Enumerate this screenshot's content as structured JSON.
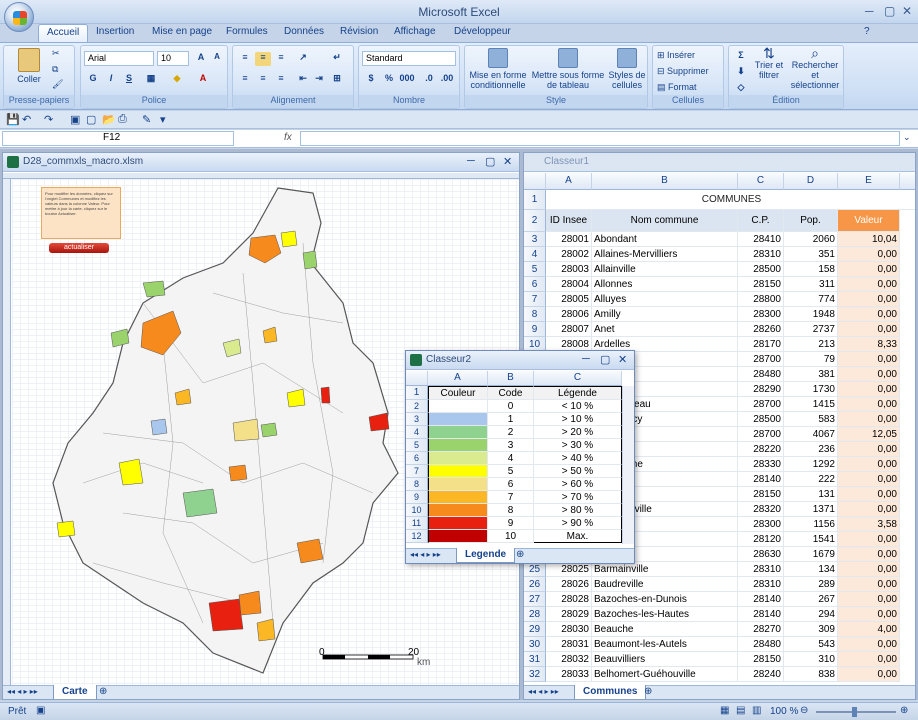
{
  "app": {
    "title": "Microsoft Excel"
  },
  "tabs": [
    "Accueil",
    "Insertion",
    "Mise en page",
    "Formules",
    "Données",
    "Révision",
    "Affichage",
    "Développeur"
  ],
  "ribbon": {
    "clipboard": {
      "label": "Presse-papiers",
      "paste": "Coller"
    },
    "font": {
      "label": "Police",
      "name": "Arial",
      "size": "10"
    },
    "alignment": {
      "label": "Alignement"
    },
    "number": {
      "label": "Nombre",
      "format": "Standard"
    },
    "style": {
      "label": "Style",
      "cond": "Mise en forme conditionnelle",
      "table": "Mettre sous forme de tableau",
      "cells": "Styles de cellules"
    },
    "cells": {
      "label": "Cellules",
      "insert": "Insérer",
      "delete": "Supprimer",
      "format": "Format"
    },
    "edit": {
      "label": "Édition",
      "sort": "Trier et filtrer",
      "find": "Rechercher et sélectionner"
    }
  },
  "formula": {
    "namebox": "F12",
    "fx": "fx"
  },
  "win1": {
    "title": "D28_commxls_macro.xlsm",
    "tab": "Carte",
    "btn": "actualiser",
    "note": "Pour modifier les données, cliquez sur l'onglet Communes et modifiez les valeurs dans la colonne Valeur. Pour mettre à jour la carte, cliquez sur le bouton Actualiser.",
    "scale0": "0",
    "scale20": "20",
    "scaleunit": "km"
  },
  "win2": {
    "title": "Classeur1",
    "tab": "Communes",
    "cols": [
      "A",
      "B",
      "C",
      "D",
      "E"
    ],
    "header": "COMMUNES",
    "colnames": {
      "id": "ID Insee",
      "nom": "Nom commune",
      "cp": "C.P.",
      "pop": "Pop.",
      "val": "Valeur"
    },
    "rows": [
      [
        "3",
        "28001",
        "Abondant",
        "28410",
        "2060",
        "10,04"
      ],
      [
        "4",
        "28002",
        "Allaines-Mervilliers",
        "28310",
        "351",
        "0,00"
      ],
      [
        "5",
        "28003",
        "Allainville",
        "28500",
        "158",
        "0,00"
      ],
      [
        "6",
        "28004",
        "Allonnes",
        "28150",
        "311",
        "0,00"
      ],
      [
        "7",
        "28005",
        "Alluyes",
        "28800",
        "774",
        "0,00"
      ],
      [
        "8",
        "28006",
        "Amilly",
        "28300",
        "1948",
        "0,00"
      ],
      [
        "9",
        "28007",
        "Anet",
        "28260",
        "2737",
        "0,00"
      ],
      [
        "10",
        "28008",
        "Ardelles",
        "28170",
        "213",
        "8,33"
      ],
      [
        "11",
        "",
        "",
        "28700",
        "79",
        "0,00"
      ],
      [
        "12",
        "",
        "...ers",
        "28480",
        "381",
        "0,00"
      ],
      [
        "13",
        "",
        "",
        "28290",
        "1730",
        "0,00"
      ],
      [
        "14",
        "",
        "...us-Auneau",
        "28700",
        "1415",
        "0,00"
      ],
      [
        "15",
        "",
        "...us-Crécy",
        "28500",
        "583",
        "0,00"
      ],
      [
        "16",
        "",
        "",
        "28700",
        "4067",
        "12,05"
      ],
      [
        "17",
        "",
        "",
        "28220",
        "236",
        "0,00"
      ],
      [
        "18",
        "",
        "...u-Perche",
        "28330",
        "1292",
        "0,00"
      ],
      [
        "19",
        "",
        "...x",
        "28140",
        "222",
        "0,00"
      ],
      [
        "20",
        "",
        "",
        "28150",
        "131",
        "0,00"
      ],
      [
        "21",
        "",
        "Armenonville",
        "28320",
        "1371",
        "0,00"
      ],
      [
        "22",
        "",
        "'Évêque",
        "28300",
        "1156",
        "3,58"
      ],
      [
        "23",
        "",
        "e-Pin",
        "28120",
        "1541",
        "0,00"
      ],
      [
        "24",
        "",
        "e",
        "28630",
        "1679",
        "0,00"
      ],
      [
        "25",
        "28025",
        "Barmainville",
        "28310",
        "134",
        "0,00"
      ],
      [
        "26",
        "28026",
        "Baudreville",
        "28310",
        "289",
        "0,00"
      ],
      [
        "27",
        "28028",
        "Bazoches-en-Dunois",
        "28140",
        "267",
        "0,00"
      ],
      [
        "28",
        "28029",
        "Bazoches-les-Hautes",
        "28140",
        "294",
        "0,00"
      ],
      [
        "29",
        "28030",
        "Beauche",
        "28270",
        "309",
        "4,00"
      ],
      [
        "30",
        "28031",
        "Beaumont-les-Autels",
        "28480",
        "543",
        "0,00"
      ],
      [
        "31",
        "28032",
        "Beauvilliers",
        "28150",
        "310",
        "0,00"
      ],
      [
        "32",
        "28033",
        "Belhomert-Guéhouville",
        "28240",
        "838",
        "0,00"
      ]
    ]
  },
  "win3": {
    "title": "Classeur2",
    "tab": "Legende",
    "cols": [
      "A",
      "B",
      "C"
    ],
    "head": [
      "Couleur",
      "Code",
      "Légende"
    ],
    "rows": [
      {
        "color": "#ffffff",
        "code": "0",
        "leg": "< 10 %"
      },
      {
        "color": "#a9c7ec",
        "code": "1",
        "leg": "> 10 %"
      },
      {
        "color": "#8fd28f",
        "code": "2",
        "leg": "> 20 %"
      },
      {
        "color": "#9ad36b",
        "code": "3",
        "leg": "> 30 %"
      },
      {
        "color": "#d9ea8f",
        "code": "4",
        "leg": "> 40 %"
      },
      {
        "color": "#ffff00",
        "code": "5",
        "leg": "> 50 %"
      },
      {
        "color": "#f5e08a",
        "code": "6",
        "leg": "> 60 %"
      },
      {
        "color": "#fbb724",
        "code": "7",
        "leg": "> 70 %"
      },
      {
        "color": "#f78a1d",
        "code": "8",
        "leg": "> 80 %"
      },
      {
        "color": "#e82010",
        "code": "9",
        "leg": "> 90 %"
      },
      {
        "color": "#c00000",
        "code": "10",
        "leg": "Max."
      }
    ]
  },
  "status": {
    "ready": "Prêt",
    "zoom": "100 %"
  }
}
